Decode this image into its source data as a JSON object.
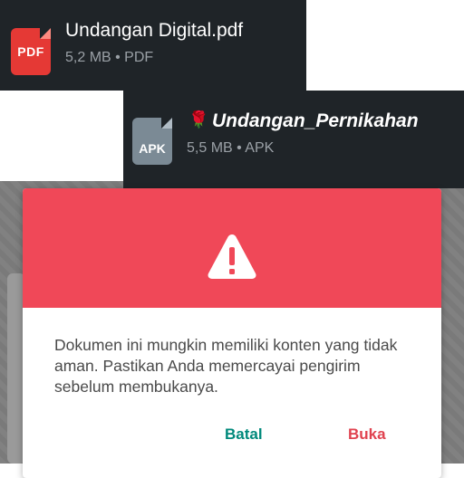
{
  "files": [
    {
      "icon": "pdf-icon",
      "icon_label": "PDF",
      "name": "Undangan Digital.pdf",
      "meta": "5,2 MB • PDF",
      "color": "#e53935"
    },
    {
      "icon": "apk-icon",
      "icon_label": "APK",
      "emoji": "🌹",
      "name": "Undangan_Pernikahan",
      "meta": "5,5 MB • APK",
      "color": "#7b8a95"
    }
  ],
  "dialog": {
    "header_color": "#f04858",
    "icon": "warning-icon",
    "message": "Dokumen ini mungkin memiliki konten yang tidak aman. Pastikan Anda memercayai pengirim sebelum membukanya.",
    "cancel_label": "Batal",
    "open_label": "Buka",
    "cancel_color": "#00897b",
    "open_color": "#e0424f"
  }
}
